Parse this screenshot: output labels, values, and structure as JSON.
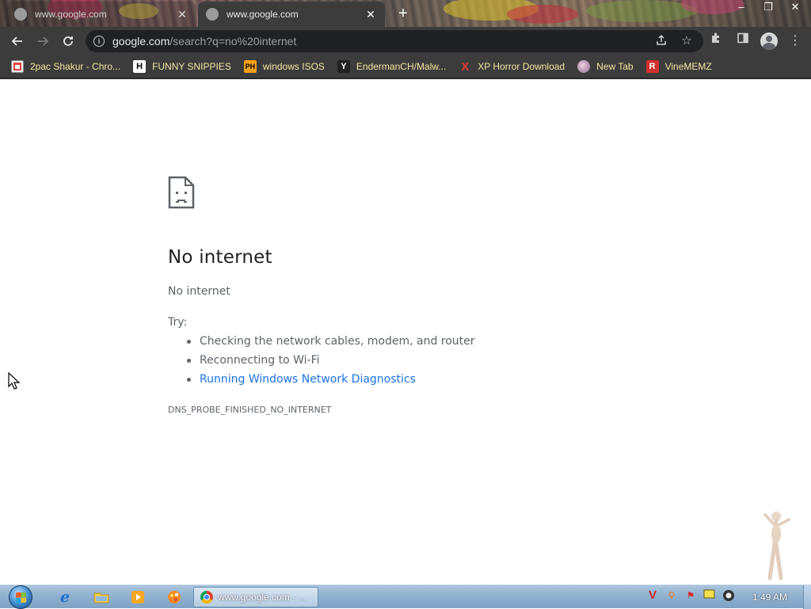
{
  "browser": {
    "tabs": [
      {
        "title": "www.google.com",
        "active": false
      },
      {
        "title": "www.google.com",
        "active": true
      }
    ],
    "new_tab_symbol": "+",
    "window_controls": {
      "minimize": "–",
      "restore": "❐",
      "close": "✕"
    },
    "address": {
      "host": "google.com",
      "path": "/search?q=no%20internet"
    }
  },
  "bookmarks": [
    {
      "label": "2pac Shakur - Chro...",
      "icon": "page-icon"
    },
    {
      "label": "FUNNY SNIPPIES",
      "icon": "h-icon",
      "glyph": "H"
    },
    {
      "label": "windows ISOS",
      "icon": "ph-icon",
      "glyph": "PH"
    },
    {
      "label": "EndermanCH/Malw...",
      "icon": "yp-icon",
      "glyph": "Y"
    },
    {
      "label": "XP Horror Download",
      "icon": "x-icon",
      "glyph": "X"
    },
    {
      "label": "New Tab",
      "icon": "globe-icon"
    },
    {
      "label": "VineMEMZ",
      "icon": "r-icon",
      "glyph": "R"
    }
  ],
  "error_page": {
    "title": "No internet",
    "subtitle": "No internet",
    "try_label": "Try:",
    "suggestions": [
      "Checking the network cables, modem, and router",
      "Reconnecting to Wi-Fi"
    ],
    "diagnostics_link": "Running Windows Network Diagnostics",
    "error_code": "DNS_PROBE_FINISHED_NO_INTERNET"
  },
  "taskbar": {
    "active_task": "www.google.com - ...",
    "clock": "1:49 AM"
  },
  "colors": {
    "link": "#1a73e8",
    "bookmark_text": "#f3e6a0",
    "chrome_dark": "#3c3c3c"
  }
}
